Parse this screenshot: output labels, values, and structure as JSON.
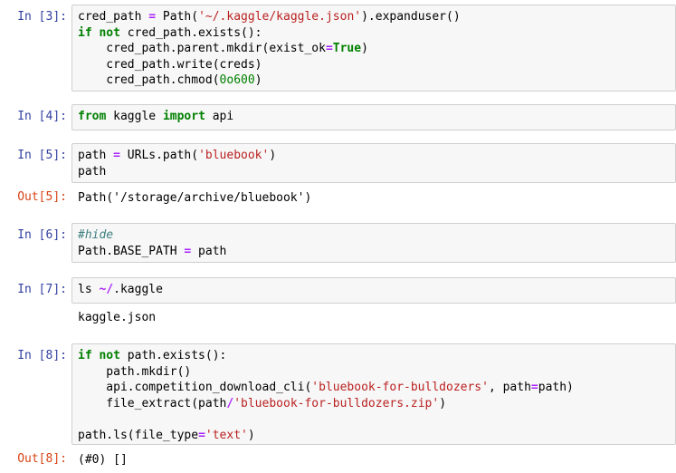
{
  "cells": [
    {
      "prompt": "In [3]:",
      "lines": [
        [
          [
            "",
            "cred_path "
          ],
          [
            "op",
            "="
          ],
          [
            "",
            " Path("
          ],
          [
            "str",
            "'~/.kaggle/kaggle.json'"
          ],
          [
            "",
            ").expanduser()"
          ]
        ],
        [
          [
            "kw",
            "if"
          ],
          [
            "",
            " "
          ],
          [
            "kw",
            "not"
          ],
          [
            "",
            " cred_path.exists():"
          ]
        ],
        [
          [
            "",
            "    cred_path.parent.mkdir(exist_ok"
          ],
          [
            "op",
            "="
          ],
          [
            "kw",
            "True"
          ],
          [
            "",
            ")"
          ]
        ],
        [
          [
            "",
            "    cred_path.write(creds)"
          ]
        ],
        [
          [
            "",
            "    cred_path.chmod("
          ],
          [
            "num",
            "0o600"
          ],
          [
            "",
            ")"
          ]
        ]
      ]
    },
    {
      "prompt": "In [4]:",
      "lines": [
        [
          [
            "kw",
            "from"
          ],
          [
            "",
            " kaggle "
          ],
          [
            "kw",
            "import"
          ],
          [
            "",
            " api"
          ]
        ]
      ]
    },
    {
      "prompt": "In [5]:",
      "lines": [
        [
          [
            "",
            "path "
          ],
          [
            "op",
            "="
          ],
          [
            "",
            " URLs.path("
          ],
          [
            "str",
            "'bluebook'"
          ],
          [
            "",
            ")"
          ]
        ],
        [
          [
            "",
            "path"
          ]
        ]
      ],
      "out_prompt": "Out[5]:",
      "output": "Path('/storage/archive/bluebook')"
    },
    {
      "prompt": "In [6]:",
      "lines": [
        [
          [
            "cmt",
            "#hide"
          ]
        ],
        [
          [
            "",
            "Path.BASE_PATH "
          ],
          [
            "op",
            "="
          ],
          [
            "",
            " path"
          ]
        ]
      ]
    },
    {
      "prompt": "In [7]:",
      "lines": [
        [
          [
            "",
            "ls "
          ],
          [
            "op",
            "~/"
          ],
          [
            "",
            ".kaggle"
          ]
        ]
      ],
      "output": "kaggle.json"
    },
    {
      "prompt": "In [8]:",
      "lines": [
        [
          [
            "kw",
            "if"
          ],
          [
            "",
            " "
          ],
          [
            "kw",
            "not"
          ],
          [
            "",
            " path.exists():"
          ]
        ],
        [
          [
            "",
            "    path.mkdir()"
          ]
        ],
        [
          [
            "",
            "    api.competition_download_cli("
          ],
          [
            "str",
            "'bluebook-for-bulldozers'"
          ],
          [
            "",
            ", path"
          ],
          [
            "op",
            "="
          ],
          [
            "",
            "path)"
          ]
        ],
        [
          [
            "",
            "    file_extract(path"
          ],
          [
            "op",
            "/"
          ],
          [
            "str",
            "'bluebook-for-bulldozers.zip'"
          ],
          [
            "",
            ")"
          ]
        ],
        [
          [
            "",
            ""
          ]
        ],
        [
          [
            "",
            "path.ls(file_type"
          ],
          [
            "op",
            "="
          ],
          [
            "str",
            "'text'"
          ],
          [
            "",
            ")"
          ]
        ]
      ],
      "out_prompt": "Out[8]:",
      "output": "(#0) []"
    }
  ]
}
